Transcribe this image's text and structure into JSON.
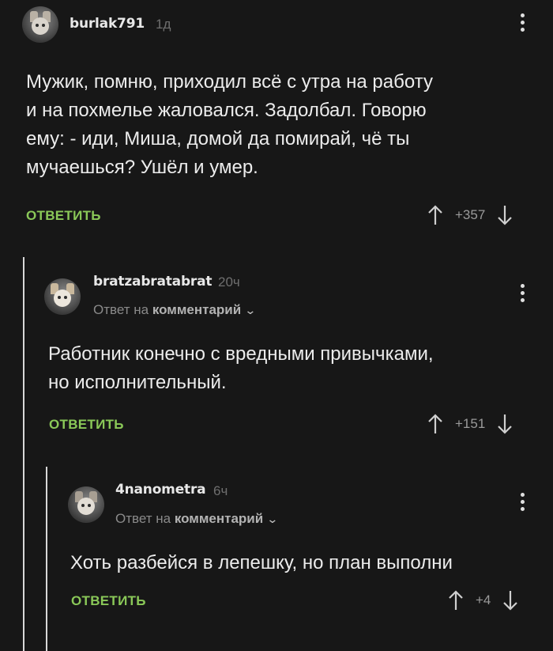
{
  "comments": [
    {
      "username": "burlak791",
      "time": "1д",
      "text_lines": [
        "Мужик, помню, приходил всё с утра на работу",
        "и на похмелье жаловался. Задолбал. Говорю",
        "ему: - иди, Миша, домой да помирай, чё ты",
        "мучаешься? Ушёл и умер."
      ],
      "reply_label": "ОТВЕТИТЬ",
      "score": "+357"
    },
    {
      "username": "bratzabratabrat",
      "time": "20ч",
      "reply_prefix": "Ответ на",
      "reply_target": "комментарий",
      "text_lines": [
        "Работник конечно с вредными привычками,",
        "но исполнительный."
      ],
      "reply_label": "ОТВЕТИТЬ",
      "score": "+151"
    },
    {
      "username": "4nanometra",
      "time": "6ч",
      "reply_prefix": "Ответ на",
      "reply_target": "комментарий",
      "text_lines": [
        "Хоть разбейся в лепешку, но план выполни"
      ],
      "reply_label": "ОТВЕТИТЬ",
      "score": "+4"
    }
  ],
  "icons": {
    "upvote": "arrow-up-icon",
    "downvote": "arrow-down-icon",
    "menu": "more-vertical-icon",
    "chevron": "chevron-down-icon"
  },
  "colors": {
    "background": "#171717",
    "accent": "#8ac858",
    "muted": "#6f6f6f"
  }
}
